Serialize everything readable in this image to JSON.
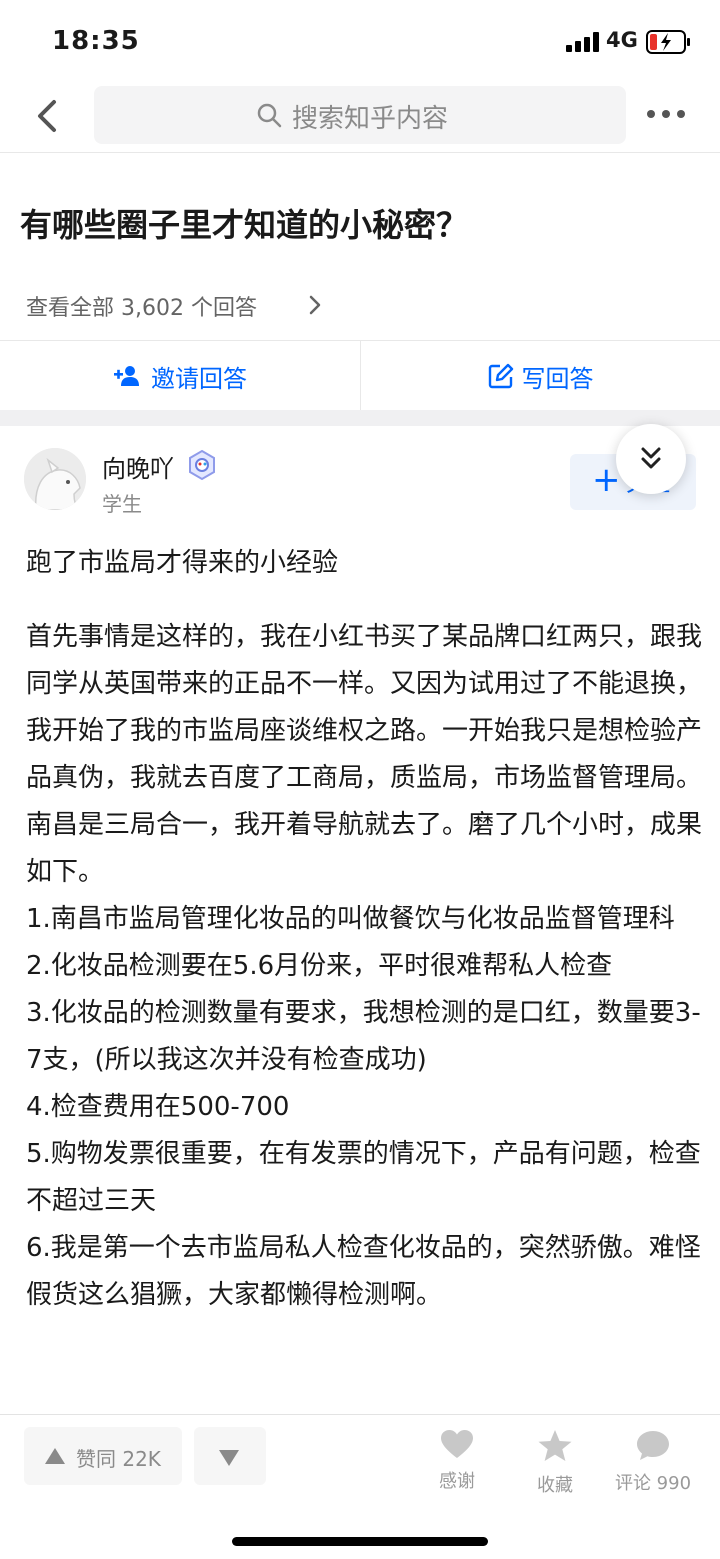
{
  "status": {
    "time": "18:35",
    "network": "4G"
  },
  "nav": {
    "search_placeholder": "搜索知乎内容"
  },
  "question": {
    "title": "有哪些圈子里才知道的小秘密？",
    "view_all": "查看全部 3,602 个回答"
  },
  "actions": {
    "invite": "邀请回答",
    "write": "写回答"
  },
  "answer": {
    "author": "向晚吖",
    "role": "学生",
    "follow_label": "关注",
    "summary": "跑了市监局才得来的小经验",
    "paragraphs": [
      "首先事情是这样的，我在小红书买了某品牌口红两只，跟我同学从英国带来的正品不一样。又因为试用过了不能退换，我开始了我的市监局座谈维权之路。一开始我只是想检验产品真伪，我就去百度了工商局，质监局，市场监督管理局。南昌是三局合一，我开着导航就去了。磨了几个小时，成果如下。",
      "1.南昌市监局管理化妆品的叫做餐饮与化妆品监督管理科",
      "2.化妆品检测要在5.6月份来，平时很难帮私人检查",
      "3.化妆品的检测数量有要求，我想检测的是口红，数量要3-7支，(所以我这次并没有检查成功)",
      "4.检查费用在500-700",
      "5.购物发票很重要，在有发票的情况下，产品有问题，检查不超过三天",
      "6.我是第一个去市监局私人检查化妆品的，突然骄傲。难怪假货这么猖獗，大家都懒得检测啊。"
    ]
  },
  "bottom": {
    "upvote": "赞同 22K",
    "thanks": "感谢",
    "favorite": "收藏",
    "comment": "评论 990"
  },
  "colors": {
    "accent": "#0066ff",
    "battery_low": "#e8322b"
  }
}
